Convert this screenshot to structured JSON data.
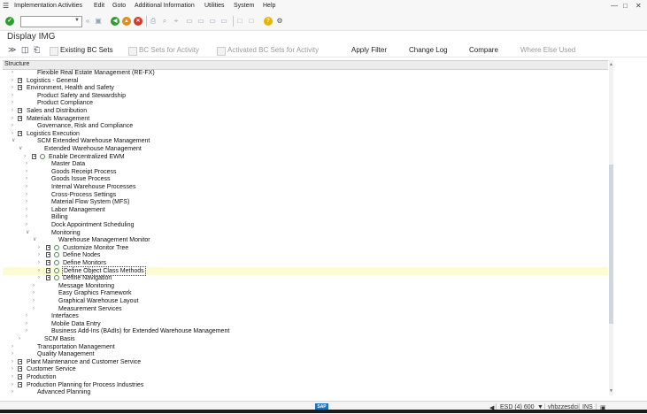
{
  "menubar": {
    "items": [
      "Implementation Activities",
      "Edit",
      "Goto",
      "Additional Information",
      "Utilities",
      "System",
      "Help"
    ]
  },
  "toolbar": {
    "command_field_value": ""
  },
  "title": "Display IMG",
  "app_toolbar": {
    "buttons": [
      {
        "label": "Existing BC Sets",
        "enabled": true
      },
      {
        "label": "BC Sets for Activity",
        "enabled": false
      },
      {
        "label": "Activated BC Sets for Activity",
        "enabled": false
      },
      {
        "label": "Apply Filter",
        "enabled": true
      },
      {
        "label": "Change Log",
        "enabled": true
      },
      {
        "label": "Compare",
        "enabled": true
      },
      {
        "label": "Where Else Used",
        "enabled": false
      }
    ]
  },
  "structure_header": "Structure",
  "tree": [
    {
      "level": 0,
      "label": "Flexible Real Estate Management (RE-FX)",
      "expanded": false,
      "doc": false,
      "clock": false
    },
    {
      "level": 0,
      "label": "Logistics - General",
      "expanded": false,
      "doc": true,
      "clock": false
    },
    {
      "level": 0,
      "label": "Environment, Health and Safety",
      "expanded": false,
      "doc": true,
      "clock": false
    },
    {
      "level": 0,
      "label": "Product Safety and Stewardship",
      "expanded": false,
      "doc": false,
      "clock": false
    },
    {
      "level": 0,
      "label": "Product Compliance",
      "expanded": false,
      "doc": false,
      "clock": false
    },
    {
      "level": 0,
      "label": "Sales and Distribution",
      "expanded": false,
      "doc": true,
      "clock": false
    },
    {
      "level": 0,
      "label": "Materials Management",
      "expanded": false,
      "doc": true,
      "clock": false
    },
    {
      "level": 0,
      "label": "Governance, Risk and Compliance",
      "expanded": false,
      "doc": false,
      "clock": false
    },
    {
      "level": 0,
      "label": "Logistics Execution",
      "expanded": false,
      "doc": true,
      "clock": false
    },
    {
      "level": 0,
      "label": "SCM Extended Warehouse Management",
      "expanded": true,
      "doc": false,
      "clock": false
    },
    {
      "level": 1,
      "label": "Extended Warehouse Management",
      "expanded": true,
      "doc": false,
      "clock": false
    },
    {
      "level": 2,
      "label": "Enable Decentralized EWM",
      "expanded": false,
      "doc": true,
      "clock": true,
      "bullet": true
    },
    {
      "level": 2,
      "label": "Master Data",
      "expanded": false,
      "doc": false,
      "clock": false
    },
    {
      "level": 2,
      "label": "Goods Receipt Process",
      "expanded": false,
      "doc": false,
      "clock": false
    },
    {
      "level": 2,
      "label": "Goods Issue Process",
      "expanded": false,
      "doc": false,
      "clock": false
    },
    {
      "level": 2,
      "label": "Internal Warehouse Processes",
      "expanded": false,
      "doc": false,
      "clock": false
    },
    {
      "level": 2,
      "label": "Cross-Process Settings",
      "expanded": false,
      "doc": false,
      "clock": false
    },
    {
      "level": 2,
      "label": "Material Flow System (MFS)",
      "expanded": false,
      "doc": false,
      "clock": false
    },
    {
      "level": 2,
      "label": "Labor Management",
      "expanded": false,
      "doc": false,
      "clock": false
    },
    {
      "level": 2,
      "label": "Billing",
      "expanded": false,
      "doc": false,
      "clock": false
    },
    {
      "level": 2,
      "label": "Dock Appointment Scheduling",
      "expanded": false,
      "doc": false,
      "clock": false
    },
    {
      "level": 2,
      "label": "Monitoring",
      "expanded": true,
      "doc": false,
      "clock": false
    },
    {
      "level": 3,
      "label": "Warehouse Management Monitor",
      "expanded": true,
      "doc": false,
      "clock": false
    },
    {
      "level": 4,
      "label": "Customize Monitor Tree",
      "expanded": false,
      "doc": true,
      "clock": true,
      "bullet": true
    },
    {
      "level": 4,
      "label": "Define Nodes",
      "expanded": false,
      "doc": true,
      "clock": true,
      "bullet": true
    },
    {
      "level": 4,
      "label": "Define Monitors",
      "expanded": false,
      "doc": true,
      "clock": true,
      "bullet": true
    },
    {
      "level": 4,
      "label": "Define Object Class Methods",
      "expanded": false,
      "doc": true,
      "clock": true,
      "bullet": true,
      "selected": true
    },
    {
      "level": 4,
      "label": "Define Navigation",
      "expanded": false,
      "doc": true,
      "clock": true,
      "bullet": true
    },
    {
      "level": 3,
      "label": "Message Monitoring",
      "expanded": false,
      "doc": false,
      "clock": false
    },
    {
      "level": 3,
      "label": "Easy Graphics Framework",
      "expanded": false,
      "doc": false,
      "clock": false
    },
    {
      "level": 3,
      "label": "Graphical Warehouse Layout",
      "expanded": false,
      "doc": false,
      "clock": false
    },
    {
      "level": 3,
      "label": "Measurement Services",
      "expanded": false,
      "doc": false,
      "clock": false
    },
    {
      "level": 2,
      "label": "Interfaces",
      "expanded": false,
      "doc": false,
      "clock": false
    },
    {
      "level": 2,
      "label": "Mobile Data Entry",
      "expanded": false,
      "doc": false,
      "clock": false
    },
    {
      "level": 2,
      "label": "Business Add-Ins (BAdIs) for Extended Warehouse Management",
      "expanded": false,
      "doc": false,
      "clock": false
    },
    {
      "level": 1,
      "label": "SCM Basis",
      "expanded": false,
      "doc": false,
      "clock": false
    },
    {
      "level": 0,
      "label": "Transportation Management",
      "expanded": false,
      "doc": false,
      "clock": false
    },
    {
      "level": 0,
      "label": "Quality Management",
      "expanded": false,
      "doc": false,
      "clock": false
    },
    {
      "level": 0,
      "label": "Plant Maintenance and Customer Service",
      "expanded": false,
      "doc": true,
      "clock": false
    },
    {
      "level": 0,
      "label": "Customer Service",
      "expanded": false,
      "doc": true,
      "clock": false
    },
    {
      "level": 0,
      "label": "Production",
      "expanded": false,
      "doc": true,
      "clock": false
    },
    {
      "level": 0,
      "label": "Production Planning for Process Industries",
      "expanded": false,
      "doc": true,
      "clock": false
    },
    {
      "level": 0,
      "label": "Advanced Planning",
      "expanded": false,
      "doc": false,
      "clock": false
    }
  ],
  "statusbar": {
    "system": "ESD (4) 600",
    "server": "vhbzzesdci",
    "mode": "INS"
  },
  "colors": {
    "selected_row": "#fdfbd2",
    "ok_green": "#2f9e2f",
    "sap_blue": "#1b75bc"
  }
}
